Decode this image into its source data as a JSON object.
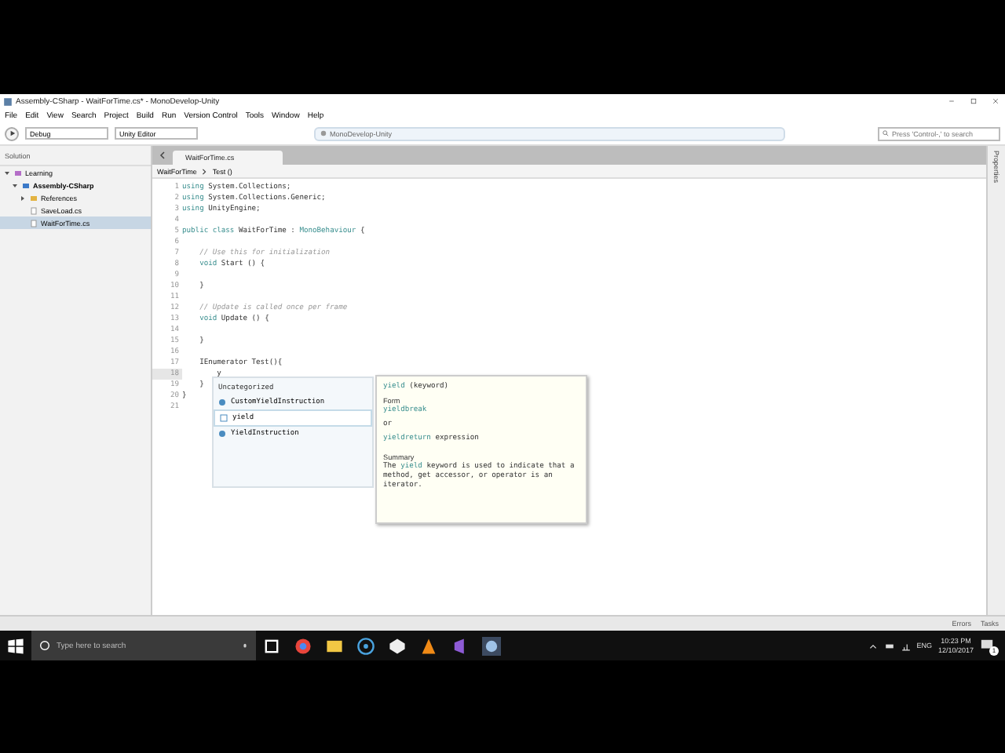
{
  "window": {
    "title": "Assembly-CSharp - WaitForTime.cs* - MonoDevelop-Unity"
  },
  "menu": [
    "File",
    "Edit",
    "View",
    "Search",
    "Project",
    "Build",
    "Run",
    "Version Control",
    "Tools",
    "Window",
    "Help"
  ],
  "toolbar": {
    "configuration": "Debug",
    "target": "Unity Editor",
    "status": "MonoDevelop-Unity",
    "search": {
      "placeholder": "Press 'Control-,' to search"
    }
  },
  "solution": {
    "title": "Solution",
    "tree": [
      {
        "label": "Learning",
        "kind": "solution",
        "expanded": true,
        "selected": false,
        "children": [
          {
            "label": "Assembly-CSharp",
            "kind": "project",
            "expanded": true,
            "selected": false,
            "children": [
              {
                "label": "References",
                "kind": "folder",
                "expanded": false,
                "selected": false
              },
              {
                "label": "SaveLoad.cs",
                "kind": "file",
                "selected": false
              },
              {
                "label": "WaitForTime.cs",
                "kind": "file",
                "selected": true
              }
            ]
          }
        ]
      }
    ]
  },
  "editor": {
    "tabs": [
      {
        "label": "WaitForTime.cs",
        "selected": true
      }
    ],
    "breadcrumb": [
      "WaitForTime",
      "Test ()"
    ],
    "lines": [
      {
        "number": "1",
        "current": false,
        "tokens": [
          {
            "kind": "keyword",
            "text": "using"
          },
          {
            "kind": "plain",
            "text": " System.Collections;"
          }
        ]
      },
      {
        "number": "2",
        "current": false,
        "tokens": [
          {
            "kind": "keyword",
            "text": "using"
          },
          {
            "kind": "plain",
            "text": " System.Collections.Generic;"
          }
        ]
      },
      {
        "number": "3",
        "current": false,
        "tokens": [
          {
            "kind": "keyword",
            "text": "using"
          },
          {
            "kind": "plain",
            "text": " UnityEngine;"
          }
        ]
      },
      {
        "number": "4",
        "current": false
      },
      {
        "number": "5",
        "current": false,
        "tokens": [
          {
            "kind": "keyword",
            "text": "public class"
          },
          {
            "kind": "plain",
            "text": " WaitForTime : "
          },
          {
            "kind": "type",
            "text": "MonoBehaviour"
          },
          {
            "kind": "plain",
            "text": " {"
          }
        ]
      },
      {
        "number": "6",
        "current": false
      },
      {
        "number": "7",
        "current": false,
        "tokens": [
          {
            "kind": "comment",
            "text": "    // Use this for initialization"
          }
        ]
      },
      {
        "number": "8",
        "current": false,
        "tokens": [
          {
            "kind": "keyword",
            "text": "    void"
          },
          {
            "kind": "plain",
            "text": " Start () {"
          }
        ]
      },
      {
        "number": "9",
        "current": false
      },
      {
        "number": "10",
        "current": false,
        "tokens": [
          {
            "kind": "plain",
            "text": "    }"
          }
        ]
      },
      {
        "number": "11",
        "current": false
      },
      {
        "number": "12",
        "current": false,
        "tokens": [
          {
            "kind": "comment",
            "text": "    // Update is called once per frame"
          }
        ]
      },
      {
        "number": "13",
        "current": false,
        "tokens": [
          {
            "kind": "keyword",
            "text": "    void"
          },
          {
            "kind": "plain",
            "text": " Update () {"
          }
        ]
      },
      {
        "number": "14",
        "current": false
      },
      {
        "number": "15",
        "current": false,
        "tokens": [
          {
            "kind": "plain",
            "text": "    }"
          }
        ]
      },
      {
        "number": "16",
        "current": false
      },
      {
        "number": "17",
        "current": false,
        "tokens": [
          {
            "kind": "plain",
            "text": "    IEnumerator Test(){"
          }
        ]
      },
      {
        "number": "18",
        "current": true,
        "tokens": [
          {
            "kind": "plain",
            "text": "        y"
          }
        ]
      },
      {
        "number": "19",
        "current": false,
        "tokens": [
          {
            "kind": "plain",
            "text": "    }"
          }
        ]
      },
      {
        "number": "20",
        "current": false,
        "tokens": [
          {
            "kind": "plain",
            "text": "}"
          }
        ]
      },
      {
        "number": "21",
        "current": false
      }
    ],
    "completion": {
      "category": "Uncategorized",
      "items": [
        {
          "label": "CustomYieldInstruction",
          "kind": "class",
          "selected": false
        },
        {
          "label": "yield",
          "kind": "keyword",
          "selected": true
        },
        {
          "label": "YieldInstruction",
          "kind": "class",
          "selected": false
        }
      ]
    },
    "tooltip": {
      "name": "yield",
      "kind_label": "(keyword)",
      "form_heading": "Form",
      "forms": [
        [
          {
            "kind": "keyword",
            "text": "yieldbreak"
          }
        ],
        [
          {
            "kind": "plain",
            "text": "or"
          }
        ],
        [
          {
            "kind": "keyword",
            "text": "yieldreturn"
          },
          {
            "kind": "plain",
            "text": " expression"
          }
        ]
      ],
      "summary_heading": "Summary",
      "summary": [
        {
          "kind": "plain",
          "text": "The "
        },
        {
          "kind": "keyword",
          "text": "yield"
        },
        {
          "kind": "plain",
          "text": " keyword is used to indicate that a method, get accessor, or operator is an iterator."
        }
      ]
    }
  },
  "properties_pad": "Properties",
  "status_bar": [
    "Errors",
    "Tasks"
  ],
  "taskbar": {
    "search": {
      "placeholder": "Type here to search"
    },
    "language": "ENG",
    "time": "10:23 PM",
    "date": "12/10/2017",
    "notifications": "1"
  }
}
